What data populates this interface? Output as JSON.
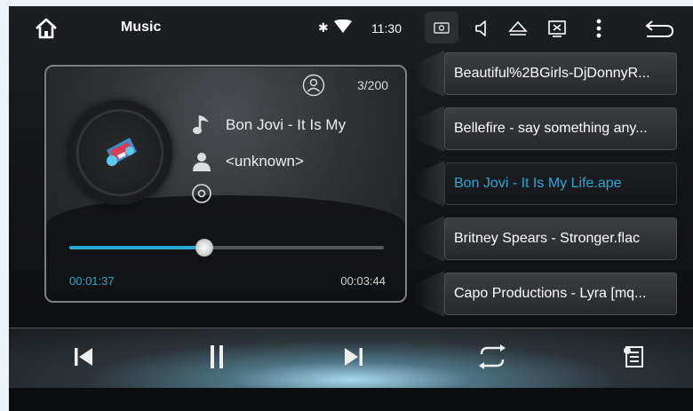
{
  "status_bar": {
    "app_title": "Music",
    "clock": "11:30",
    "icons": [
      "home-icon",
      "bluetooth-icon",
      "wifi-icon",
      "screenshot-icon",
      "volume-icon",
      "eject-icon",
      "display-off-icon",
      "overflow-menu-icon",
      "back-arrow-icon"
    ]
  },
  "player": {
    "track_counter": "3/200",
    "title": "Bon Jovi - It Is My",
    "artist": "<unknown>",
    "progress_fraction": 0.43,
    "elapsed": "00:01:37",
    "duration": "00:03:44"
  },
  "playlist": {
    "items": [
      {
        "label": "Beautiful%2BGirls-DjDonnyR..."
      },
      {
        "label": "Bellefire - say something any..."
      },
      {
        "label": "Bon Jovi - It Is My Life.ape",
        "active": true
      },
      {
        "label": "Britney Spears - Stronger.flac"
      },
      {
        "label": "Capo Productions - Lyra [mq..."
      }
    ]
  },
  "controls": [
    "previous-icon",
    "pause-icon",
    "next-icon",
    "repeat-icon",
    "playlist-icon"
  ],
  "colors": {
    "accent": "#2aa8d4",
    "background": "#131416",
    "text": "#ffffff"
  }
}
